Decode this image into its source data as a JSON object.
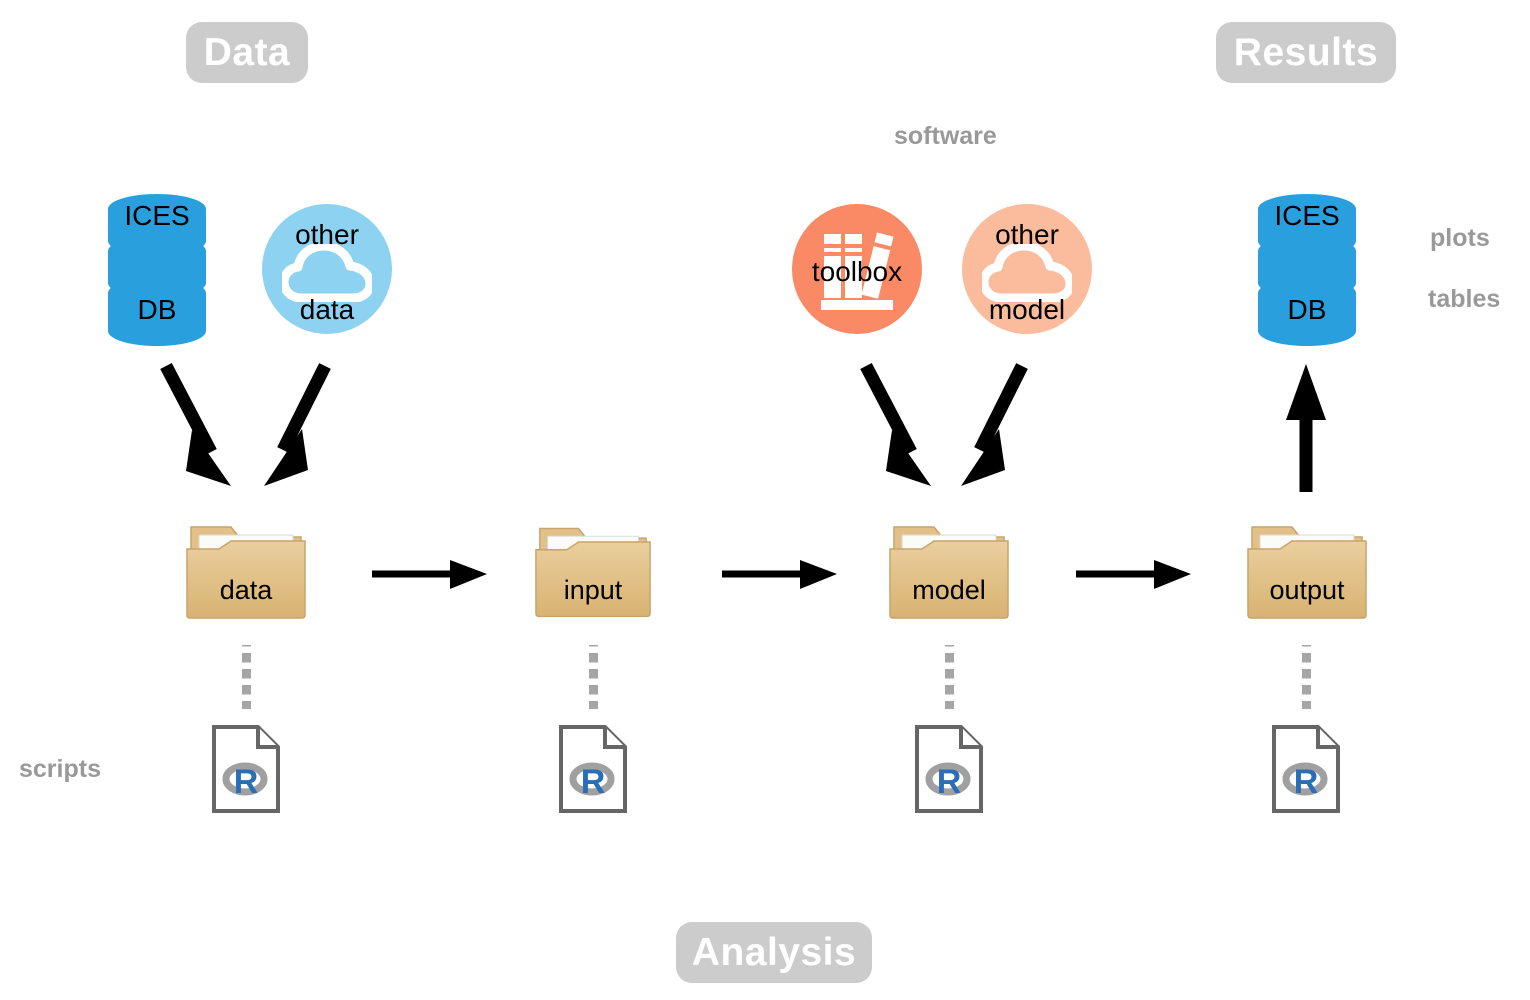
{
  "badges": {
    "data": "Data",
    "results": "Results",
    "analysis": "Analysis"
  },
  "captions": {
    "software": "software",
    "plots": "plots",
    "tables": "tables",
    "scripts": "scripts"
  },
  "sources": {
    "ices_db": {
      "top_label": "ICES",
      "bottom_label": "DB",
      "icon": "database-cylinder-icon",
      "color": "#29a0dd"
    },
    "other_data": {
      "top_label": "other",
      "bottom_label": "data",
      "icon": "cloud-icon",
      "color": "#8ed2f2"
    }
  },
  "software": {
    "toolbox": {
      "label": "toolbox",
      "icon": "books-icon",
      "color": "#fa8a66"
    },
    "other_model": {
      "top_label": "other",
      "bottom_label": "model",
      "icon": "cloud-icon",
      "color": "#fbbb9d"
    }
  },
  "results": {
    "ices_db": {
      "top_label": "ICES",
      "bottom_label": "DB",
      "icon": "database-cylinder-icon",
      "color": "#29a0dd"
    }
  },
  "folders": [
    {
      "label": "data",
      "icon": "folder-icon"
    },
    {
      "label": "input",
      "icon": "folder-icon"
    },
    {
      "label": "model",
      "icon": "folder-icon"
    },
    {
      "label": "output",
      "icon": "folder-icon"
    }
  ],
  "scripts": [
    {
      "icon": "r-script-file-icon",
      "glyph": "R"
    },
    {
      "icon": "r-script-file-icon",
      "glyph": "R"
    },
    {
      "icon": "r-script-file-icon",
      "glyph": "R"
    },
    {
      "icon": "r-script-file-icon",
      "glyph": "R"
    }
  ],
  "colors": {
    "badge_bg": "#cccccc",
    "badge_text": "#ffffff",
    "caption_text": "#999999",
    "db_blue": "#29a0dd",
    "cloud_blue": "#8ed2f2",
    "toolbox_salmon": "#fa8a66",
    "cloud_salmon": "#fbbb9d",
    "folder_tan": "#e3c088",
    "folder_edge": "#c9a46a",
    "arrow_black": "#000000",
    "dot_gray": "#a6a6a6",
    "r_blue": "#2a6eb8",
    "r_gray": "#a0a0a0"
  }
}
